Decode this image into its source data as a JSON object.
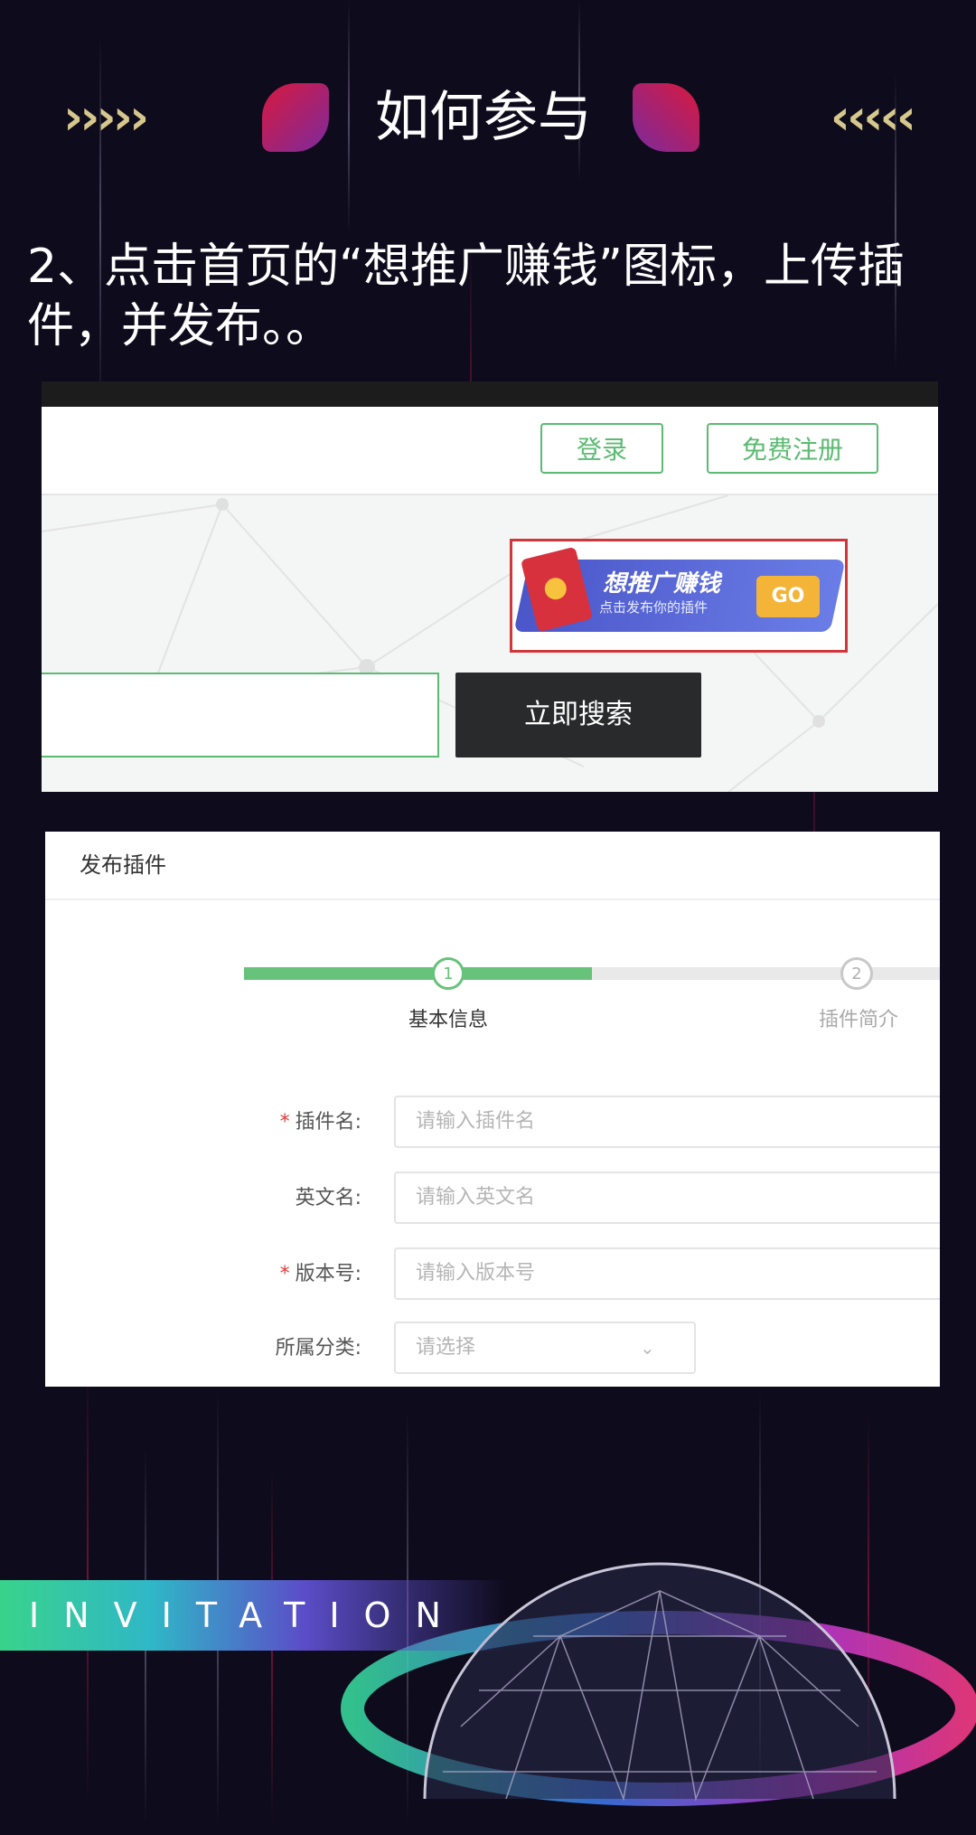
{
  "header": {
    "title": "如何参与",
    "left_decoration": "›››››",
    "right_decoration": "‹‹‹‹‹"
  },
  "instruction": "2、点击首页的“想推广赚钱”图标，上传插件，并发布。。",
  "site_screenshot": {
    "login_label": "登录",
    "register_label": "免费注册",
    "promo": {
      "title": "想推广赚钱",
      "subtitle": "点击发布你的插件",
      "go_label": "GO"
    },
    "search_button_label": "立即搜索"
  },
  "publish_form": {
    "title": "发布插件",
    "progress": 0.5,
    "steps": [
      {
        "number": "1",
        "label": "基本信息"
      },
      {
        "number": "2",
        "label": "插件简介"
      }
    ],
    "fields": [
      {
        "label": "插件名:",
        "placeholder": "请输入插件名",
        "required": true
      },
      {
        "label": "英文名:",
        "placeholder": "请输入英文名",
        "required": false
      },
      {
        "label": "版本号:",
        "placeholder": "请输入版本号",
        "required": true
      },
      {
        "label": "所属分类:",
        "placeholder": "请选择",
        "required": false
      }
    ],
    "required_mark": "*",
    "select_icon": "chevron-down-icon"
  },
  "footer": {
    "banner_text": "INVITATION"
  },
  "colors": {
    "accent_green": "#67c27a",
    "highlight_red": "#d1363a",
    "background": "#0e0b1c"
  }
}
